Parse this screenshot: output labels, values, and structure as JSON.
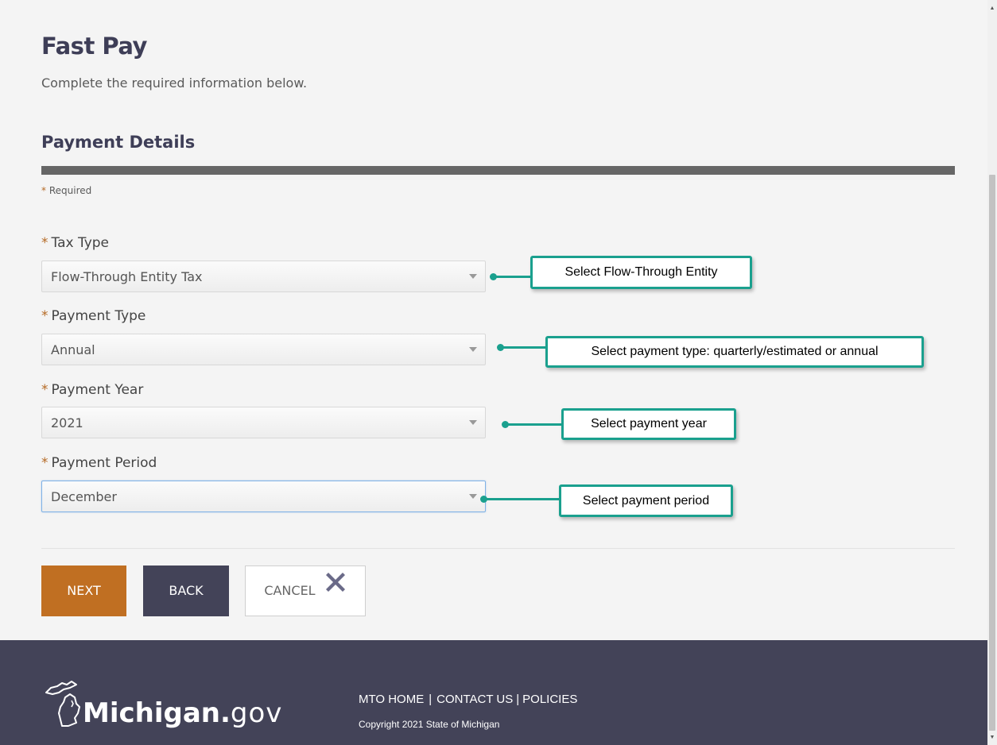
{
  "page": {
    "title": "Fast Pay",
    "subtitle": "Complete the required information below."
  },
  "section": {
    "title": "Payment Details",
    "required_star": "*",
    "required_note": "Required"
  },
  "fields": [
    {
      "label": "Tax Type",
      "value": "Flow-Through Entity Tax",
      "callout": "Select Flow-Through Entity"
    },
    {
      "label": "Payment Type",
      "value": "Annual",
      "callout": "Select payment type: quarterly/estimated or annual"
    },
    {
      "label": "Payment Year",
      "value": "2021",
      "callout": "Select payment year"
    },
    {
      "label": "Payment Period",
      "value": "December",
      "callout": "Select payment period"
    }
  ],
  "buttons": {
    "next": "NEXT",
    "back": "BACK",
    "cancel": "CANCEL"
  },
  "footer": {
    "logo_bold": "Michigan.",
    "logo_thin": "gov",
    "links": [
      "MTO HOME",
      "CONTACT US",
      "POLICIES"
    ],
    "link_separator": "|",
    "copyright": "Copyright 2021 State of Michigan"
  },
  "colors": {
    "accent": "#c06f22",
    "dark": "#434358",
    "callout_border": "#1aa08e"
  },
  "icons": {
    "cancel": "close-x-icon",
    "logo": "michigan-state-outline-icon"
  }
}
